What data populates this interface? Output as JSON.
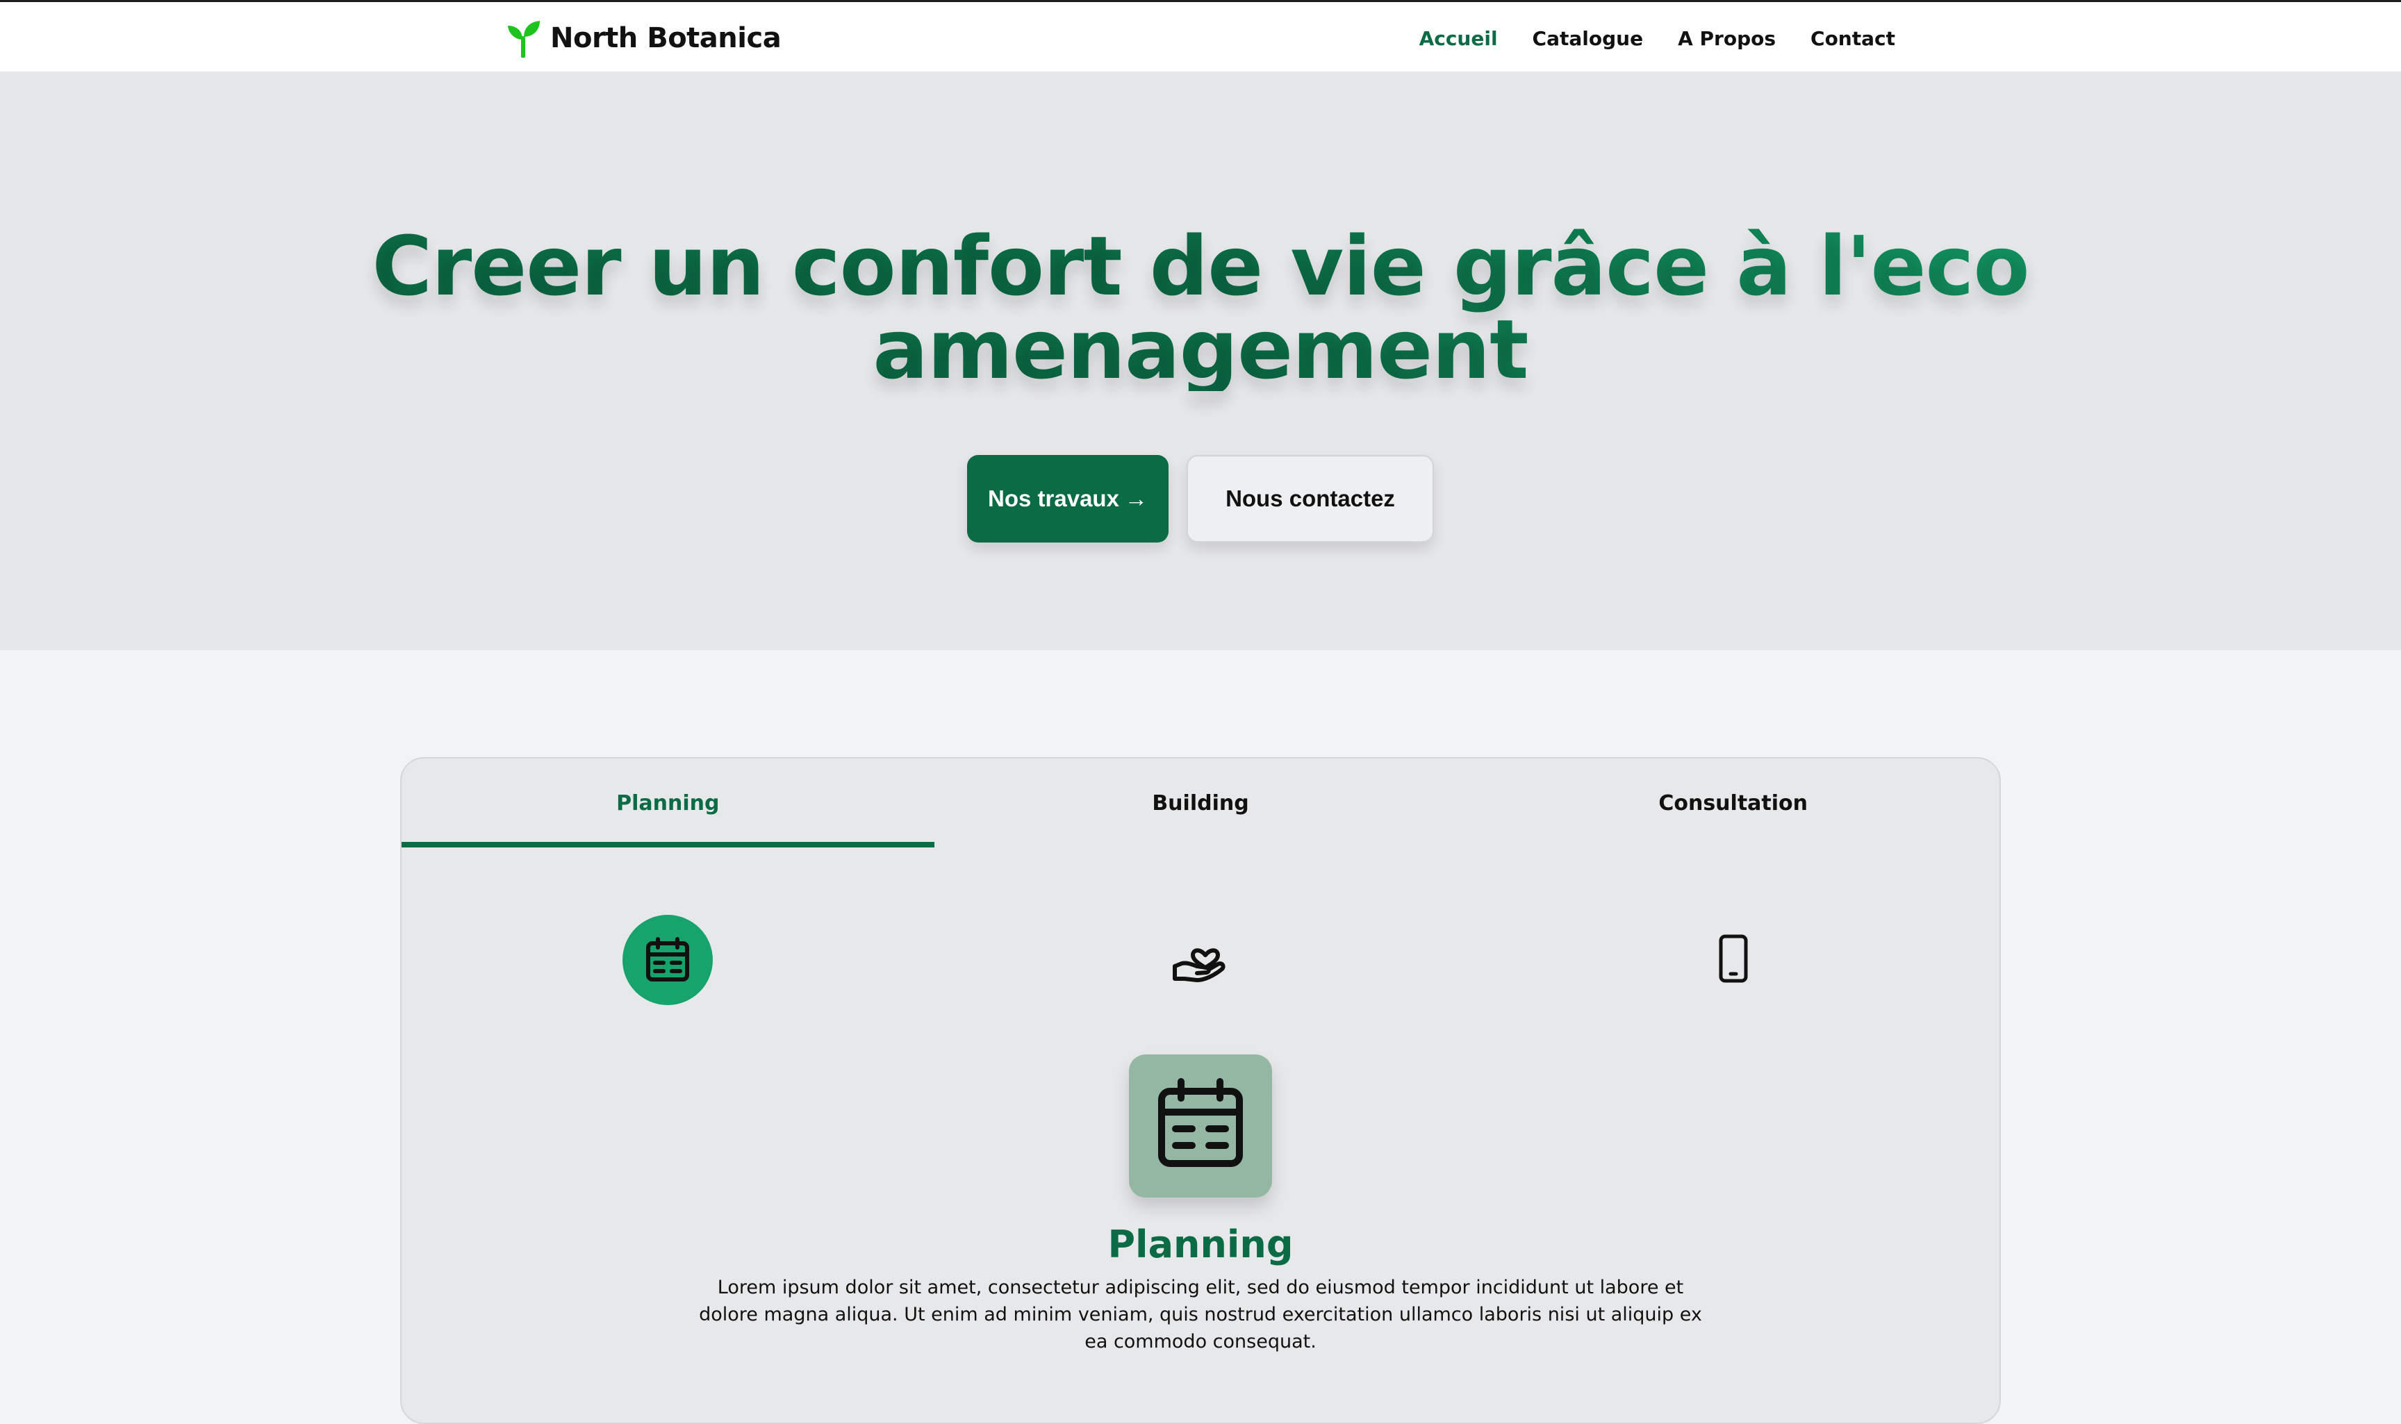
{
  "brand": {
    "name": "North Botanica",
    "icon": "sprout-icon",
    "icon_color": "#1ec31e"
  },
  "nav": {
    "items": [
      {
        "label": "Accueil",
        "active": true
      },
      {
        "label": "Catalogue",
        "active": false
      },
      {
        "label": "A Propos",
        "active": false
      },
      {
        "label": "Contact",
        "active": false
      }
    ]
  },
  "hero": {
    "title_line1": "Creer un confort de vie grâce à l'eco",
    "title_line2": "amenagement",
    "primary_button": "Nos travaux",
    "primary_button_icon": "→",
    "secondary_button": "Nous contactez"
  },
  "tabs": {
    "items": [
      {
        "label": "Planning",
        "active": true,
        "icon": "calendar-icon"
      },
      {
        "label": "Building",
        "active": false,
        "icon": "hand-heart-icon"
      },
      {
        "label": "Consultation",
        "active": false,
        "icon": "phone-icon"
      }
    ]
  },
  "feature": {
    "icon": "calendar-icon",
    "title": "Planning",
    "text": "Lorem ipsum dolor sit amet, consectetur adipiscing elit, sed do eiusmod tempor incididunt ut labore et dolore magna aliqua. Ut enim ad minim veniam, quis nostrud exercitation ullamco laboris nisi ut aliquip ex ea commodo consequat."
  },
  "colors": {
    "accent": "#0b6b45",
    "accent_light": "#16a36c",
    "tile": "#94b7a4",
    "hero_bg": "#e6e7e9",
    "page_bg": "#f2f3f5"
  }
}
